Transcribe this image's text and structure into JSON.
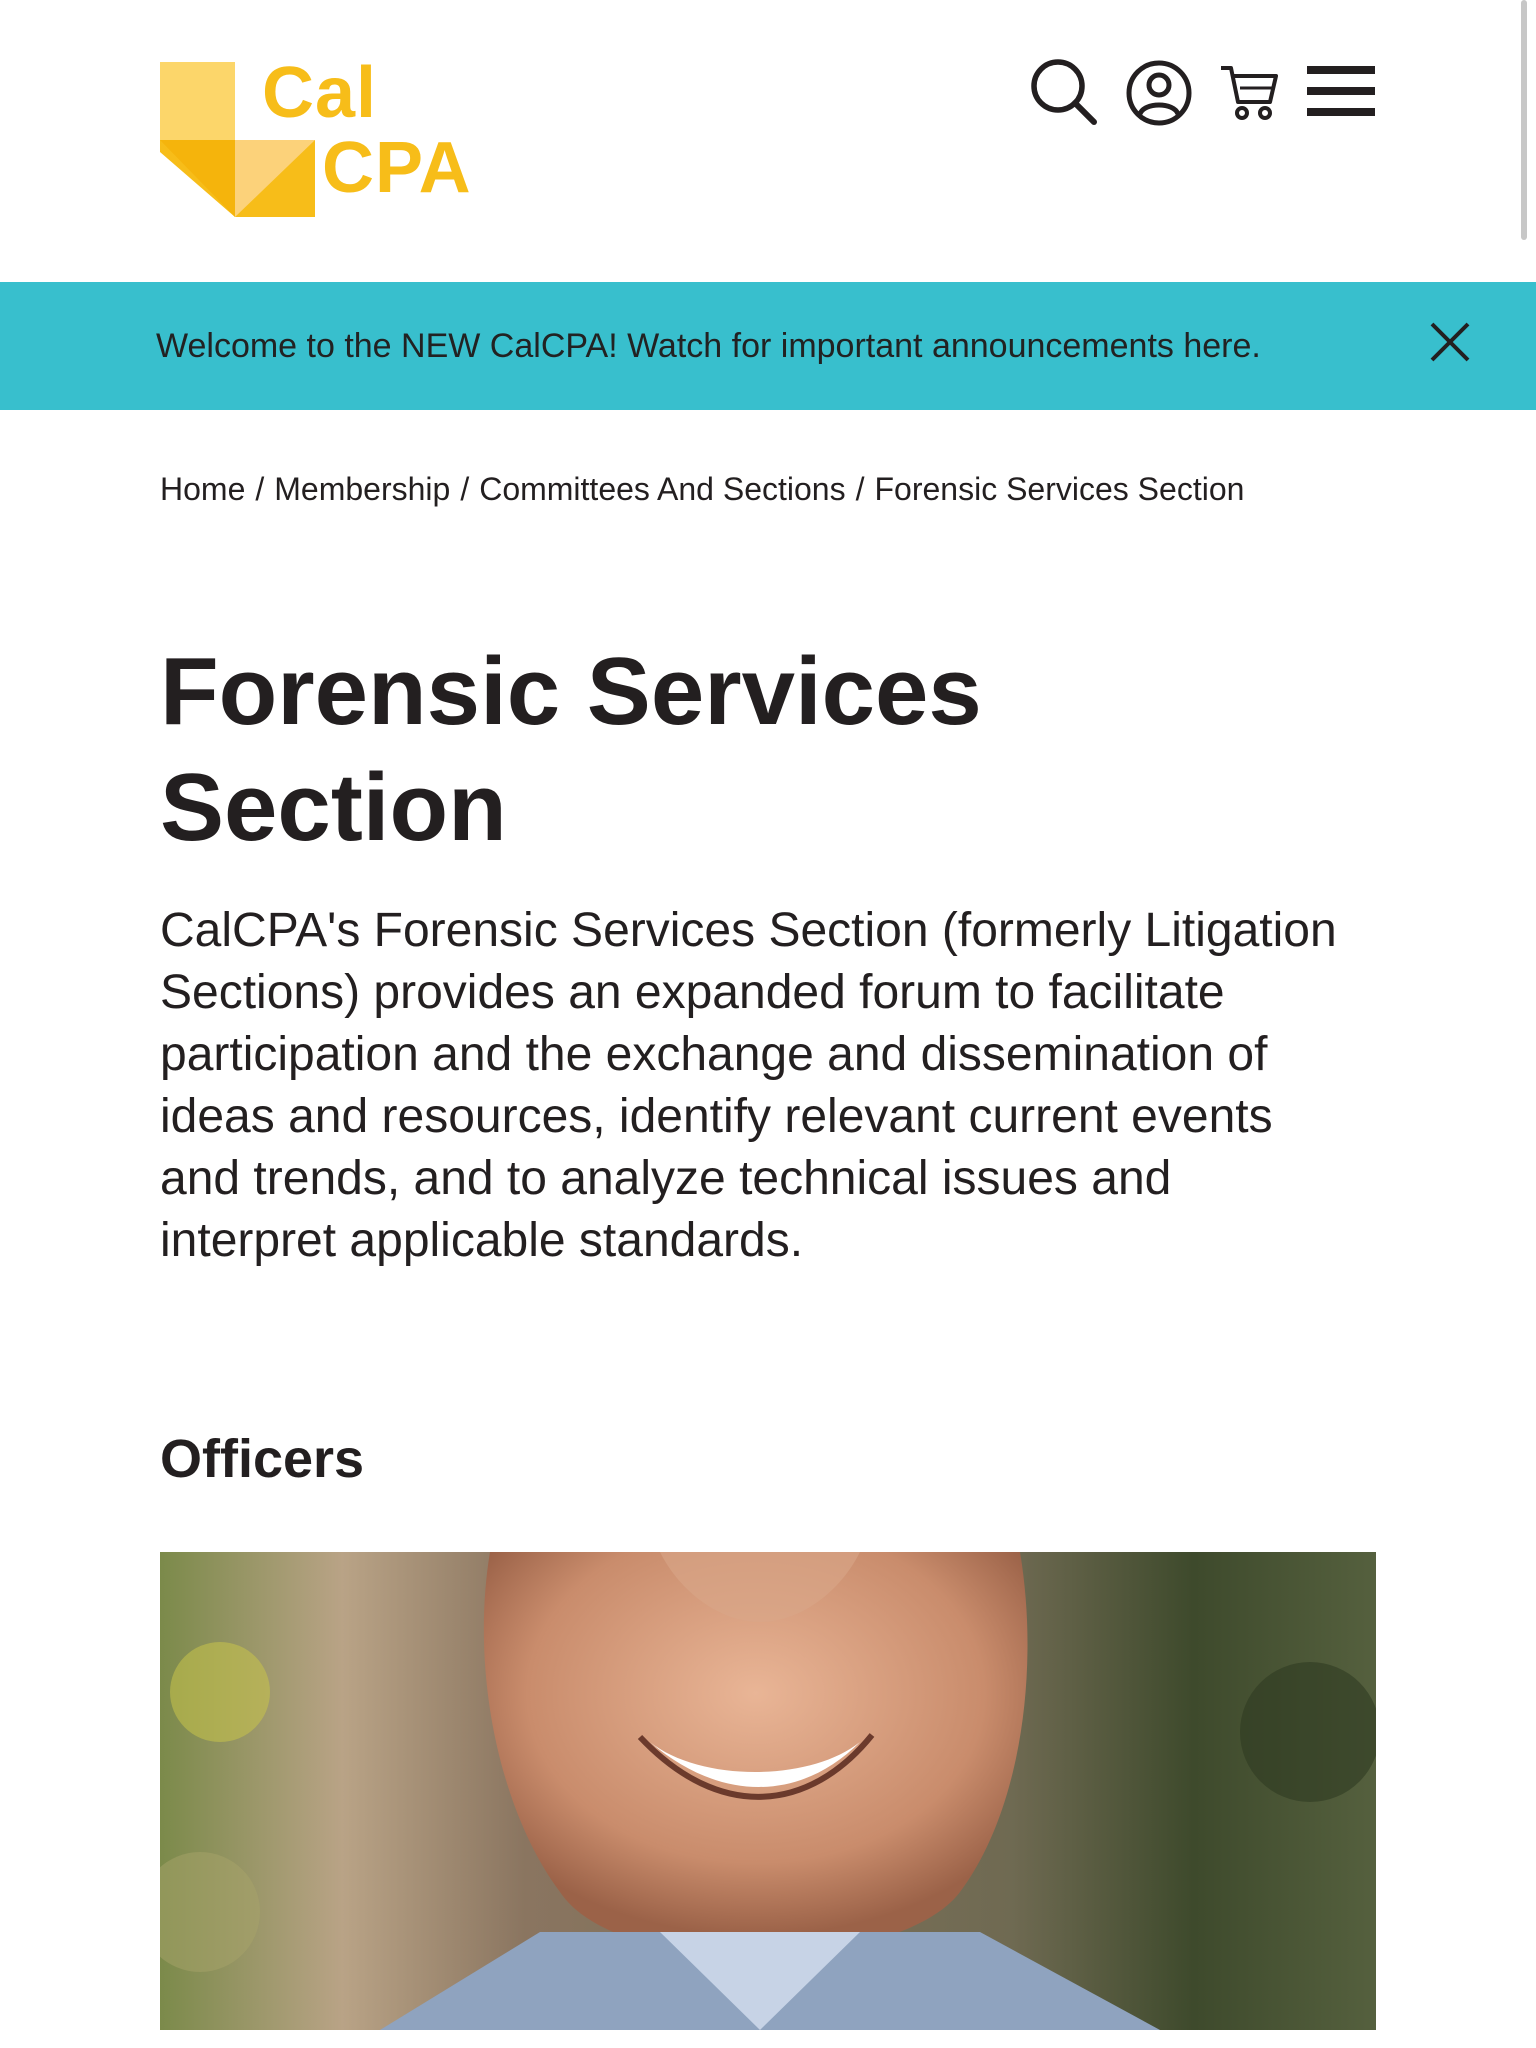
{
  "header": {
    "logo": {
      "line1": "Cal",
      "line2": "CPA",
      "brand_color": "#f7bd19"
    },
    "icons": [
      "search-icon",
      "account-icon",
      "cart-icon",
      "menu-icon"
    ]
  },
  "announcement": {
    "text": "Welcome to the NEW CalCPA! Watch for important announcements here.",
    "background": "#38bfcd"
  },
  "breadcrumb": {
    "items": [
      "Home",
      "Membership",
      "Committees And Sections",
      "Forensic Services Section"
    ],
    "separator": "/"
  },
  "main": {
    "title": "Forensic Services Section",
    "intro": "CalCPA's Forensic Services Section (formerly Litigation Sections) provides an expanded forum to facilitate participation and the exchange and dissemination of ideas and resources, identify relevant current events and trends, and to analyze technical issues and interpret applicable standards.",
    "officers_heading": "Officers"
  }
}
